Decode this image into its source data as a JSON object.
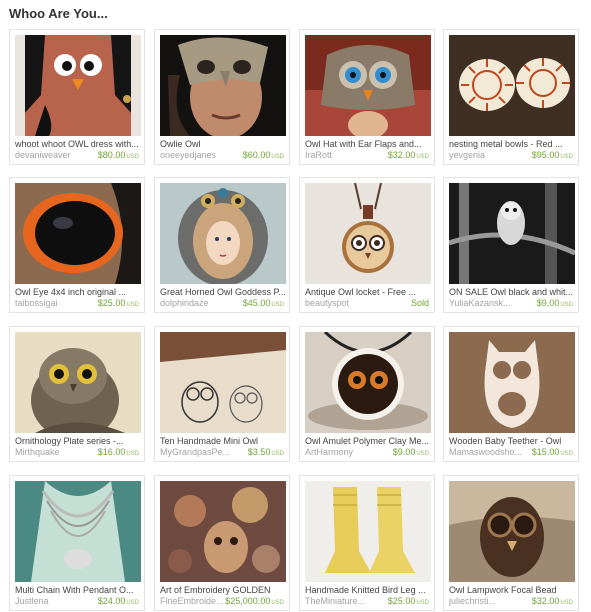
{
  "page": {
    "title": "Whoo Are You..."
  },
  "currency_label": "USD",
  "items": [
    {
      "name": "whoot whoot OWL dress with...",
      "shop": "devaniweaver",
      "price": "$80.00",
      "sold": false
    },
    {
      "name": "Owlie Owl",
      "shop": "oneeyedjanes",
      "price": "$60.00",
      "sold": false
    },
    {
      "name": "Owl Hat with Ear Flaps and...",
      "shop": "IraRott",
      "price": "$32.00",
      "sold": false
    },
    {
      "name": "nesting metal bowls - Red ...",
      "shop": "yevgenia",
      "price": "$95.00",
      "sold": false
    },
    {
      "name": "Owl Eye 4x4 inch original ...",
      "shop": "taibossigai",
      "price": "$25.00",
      "sold": false
    },
    {
      "name": "Great Horned Owl Goddess P...",
      "shop": "dolphindaze",
      "price": "$45.00",
      "sold": false
    },
    {
      "name": "Antique Owl locket - Free ...",
      "shop": "beautyspot",
      "price": "Sold",
      "sold": true
    },
    {
      "name": "ON SALE Owl black and whit...",
      "shop": "YuliaKazansk...",
      "price": "$9.00",
      "sold": false
    },
    {
      "name": "Ornithology Plate series -...",
      "shop": "Mirthquake",
      "price": "$16.00",
      "sold": false
    },
    {
      "name": "Ten Handmade Mini Owl",
      "shop": "MyGrandpasPe...",
      "price": "$3.50",
      "sold": false
    },
    {
      "name": "Owl Amulet Polymer Clay Me...",
      "shop": "ArtHarmony",
      "price": "$9.00",
      "sold": false
    },
    {
      "name": "Wooden Baby Teether - Owl",
      "shop": "Mamaswoodsho...",
      "price": "$15.00",
      "sold": false
    },
    {
      "name": "Multi Chain With Pendant O...",
      "shop": "Justlena",
      "price": "$24.00",
      "sold": false
    },
    {
      "name": "Art of Embroidery GOLDEN",
      "shop": "FineEmbroide...",
      "price": "$25,000.00",
      "sold": false
    },
    {
      "name": "Handmade Knitted Bird Leg ...",
      "shop": "TheMiniature...",
      "price": "$25.00",
      "sold": false
    },
    {
      "name": "Owl Lampwork Focal Bead",
      "shop": "juliechristi...",
      "price": "$32.00",
      "sold": false
    }
  ]
}
